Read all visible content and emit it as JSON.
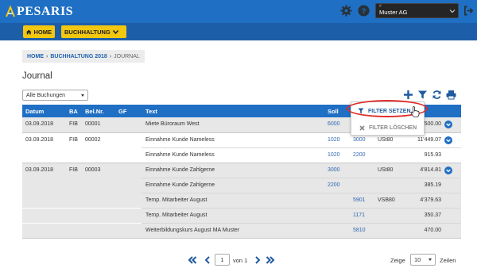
{
  "app": {
    "logo_text": "PESARIS",
    "company_hash": "#",
    "company": "Muster AG"
  },
  "nav": {
    "home_label": "HOME",
    "buchhaltung_label": "BUCHHALTUNG"
  },
  "breadcrumb": {
    "home": "HOME",
    "buchhaltung": "BUCHHALTUNG 2018",
    "current": "JOURNAL"
  },
  "page_title": "Journal",
  "filter": {
    "selected": "Alle Buchungen"
  },
  "table": {
    "columns": [
      "Datum",
      "BA",
      "Bel.Nr.",
      "GF",
      "Text",
      "Soll"
    ],
    "groups": [
      {
        "rows": [
          {
            "datum": "03.09.2018",
            "ba": "FIB",
            "belnr": "00001",
            "gf": "",
            "text": "Miete Büroraum West",
            "soll": "6000",
            "haben": "",
            "mwst": "",
            "betrag": "2'500.00"
          }
        ]
      },
      {
        "rows": [
          {
            "datum": "03.09.2018",
            "ba": "FIB",
            "belnr": "00002",
            "gf": "",
            "text": "Einnahme Kunde Nameless",
            "soll": "1020",
            "haben": "3000",
            "mwst": "USt80",
            "betrag": "11'449.07"
          },
          {
            "datum": "",
            "ba": "",
            "belnr": "",
            "gf": "",
            "text": "Einnahme Kunde Nameless",
            "soll": "1020",
            "haben": "2200",
            "mwst": "",
            "betrag": "915.93"
          }
        ]
      },
      {
        "rows": [
          {
            "datum": "03.09.2018",
            "ba": "FIB",
            "belnr": "00003",
            "gf": "",
            "text": "Einnahme Kunde Zahlgerne",
            "soll": "3000",
            "haben": "",
            "mwst": "USt80",
            "betrag": "4'814.81"
          },
          {
            "datum": "",
            "ba": "",
            "belnr": "",
            "gf": "",
            "text": "Einnahme Kunde Zahlgerne",
            "soll": "2200",
            "haben": "",
            "mwst": "",
            "betrag": "385.19"
          },
          {
            "datum": "",
            "ba": "",
            "belnr": "",
            "gf": "",
            "text": "Temp. Mitarbeiter August",
            "soll": "",
            "haben": "5901",
            "mwst": "VSB80",
            "betrag": "4'379.63"
          },
          {
            "datum": "",
            "ba": "",
            "belnr": "",
            "gf": "",
            "text": "Temp. Mitarbeiter August",
            "soll": "",
            "haben": "1171",
            "mwst": "",
            "betrag": "350.37"
          },
          {
            "datum": "",
            "ba": "",
            "belnr": "",
            "gf": "",
            "text": "Weiterbildungskurs August MA Muster",
            "soll": "",
            "haben": "5810",
            "mwst": "",
            "betrag": "470.00"
          }
        ]
      }
    ]
  },
  "filter_menu": {
    "set_label": "FILTER SETZEN",
    "clear_label": "FILTER LÖSCHEN"
  },
  "pagination": {
    "page": "1",
    "of_label": "von 1",
    "show_label": "Zeige",
    "page_size": "10",
    "rows_label": "Zeilen"
  },
  "colors": {
    "primary": "#1f6fc4",
    "nav": "#1d5ea8",
    "accent": "#f2c70f",
    "highlight": "#e12b2b",
    "link": "#2e67b3"
  }
}
